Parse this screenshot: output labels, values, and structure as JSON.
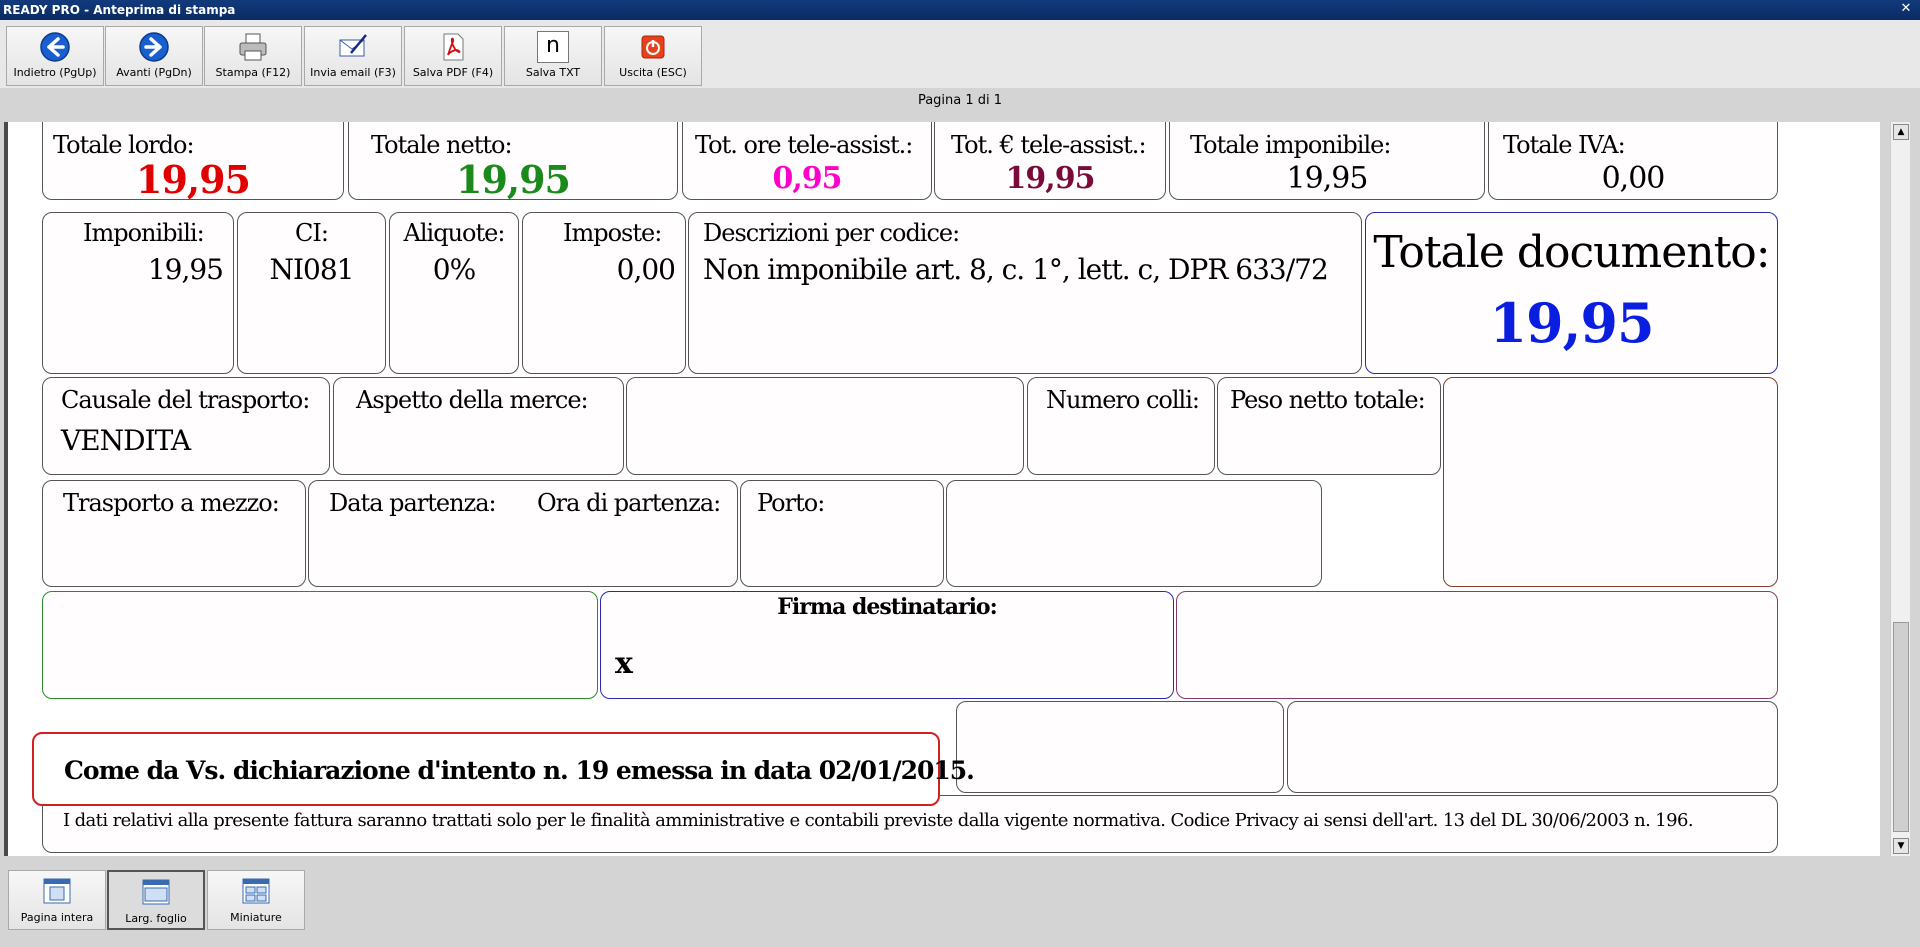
{
  "window": {
    "title": "READY PRO - Anteprima di stampa",
    "close_glyph": "✕"
  },
  "toolbar": {
    "buttons": [
      {
        "label": "Indietro (PgUp)",
        "icon": "arrow-left-icon"
      },
      {
        "label": "Avanti (PgDn)",
        "icon": "arrow-right-icon"
      },
      {
        "label": "Stampa (F12)",
        "icon": "printer-icon"
      },
      {
        "label": "Invia email (F3)",
        "icon": "email-icon"
      },
      {
        "label": "Salva PDF (F4)",
        "icon": "pdf-icon"
      },
      {
        "label": "Salva TXT",
        "icon": "txt-icon",
        "glyph": "n"
      },
      {
        "label": "Uscita (ESC)",
        "icon": "exit-icon"
      }
    ]
  },
  "page_info": "Pagina 1 di 1",
  "document": {
    "totals": {
      "lordo": {
        "label": "Totale lordo:",
        "value": "19,95",
        "color": "#e00000"
      },
      "netto": {
        "label": "Totale netto:",
        "value": "19,95",
        "color": "#1a8a1a"
      },
      "ore_tele": {
        "label": "Tot. ore tele-assist.:",
        "value": "0,95",
        "color": "#ff00cc"
      },
      "euro_tele": {
        "label": "Tot. € tele-assist.:",
        "value": "19,95",
        "color": "#7a0a3a"
      },
      "imponibile": {
        "label": "Totale imponibile:",
        "value": "19,95"
      },
      "iva": {
        "label": "Totale IVA:",
        "value": "0,00"
      }
    },
    "vat": {
      "imponibili_label": "Imponibili:",
      "imponibili_value": "19,95",
      "ci_label": "CI:",
      "ci_value": "NI081",
      "aliquote_label": "Aliquote:",
      "aliquote_value": "0%",
      "imposte_label": "Imposte:",
      "imposte_value": "0,00",
      "descr_label": "Descrizioni per codice:",
      "descr_value": "Non imponibile art. 8, c. 1°, lett. c, DPR 633/72"
    },
    "totale_documento": {
      "label": "Totale documento:",
      "value": "19,95",
      "color": "#0a1ee0"
    },
    "transport": {
      "causale_label": "Causale del trasporto:",
      "causale_value": "VENDITA",
      "aspetto_label": "Aspetto della merce:",
      "colli_label": "Numero colli:",
      "peso_label": "Peso netto totale:",
      "mezzo_label": "Trasporto a mezzo:",
      "data_label": "Data partenza:",
      "ora_label": "Ora di partenza:",
      "porto_label": "Porto:"
    },
    "firma": {
      "label": "Firma destinatario:",
      "mark": "x"
    },
    "dichiarazione": "Come da Vs. dichiarazione d'intento n. 19 emessa in data 02/01/2015.",
    "privacy": "I dati relativi alla presente fattura saranno trattati solo per le finalità amministrative e contabili previste dalla vigente normativa. Codice Privacy ai sensi dell'art. 13 del DL 30/06/2003 n. 196."
  },
  "scrollbar": {
    "up": "▲",
    "down": "▼"
  },
  "bottombar": {
    "buttons": [
      {
        "label": "Pagina intera",
        "icon": "full-page-icon"
      },
      {
        "label": "Larg. foglio",
        "icon": "page-width-icon"
      },
      {
        "label": "Miniature",
        "icon": "thumbnails-icon"
      }
    ]
  },
  "colors": {
    "accent_box_red": "#d02020",
    "box_green": "#2a8a2a",
    "box_blue": "#2a2ab0",
    "box_brown": "#8a3a2a"
  }
}
